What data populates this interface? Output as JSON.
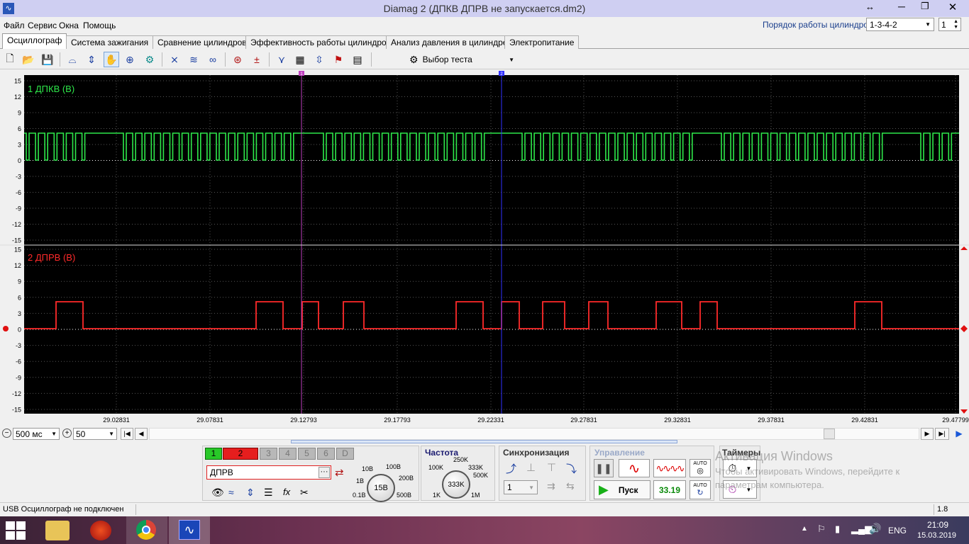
{
  "window": {
    "title": "Diamag 2 (ДПКВ ДПРВ не запускается.dm2)",
    "cylinder_order_label": "Порядок работы цилиндров",
    "cylinder_order_value": "1-3-4-2",
    "cylinder_index": "1"
  },
  "menu": [
    "Файл",
    "Сервис",
    "Окна",
    "Помощь"
  ],
  "tabs": [
    "Осциллограф",
    "Система зажигания",
    "Сравнение цилиндров",
    "Эффективность работы цилиндров",
    "Анализ давления в цилиндре",
    "Электропитание"
  ],
  "toolbar": {
    "test_select": "Выбор теста"
  },
  "scope": {
    "channel1_label": "1 ДПКВ (В)",
    "channel2_label": "2 ДПРВ (В)",
    "y_ticks": [
      "15",
      "12",
      "9",
      "6",
      "3",
      "0",
      "-3",
      "-6",
      "-9",
      "-12",
      "-15"
    ],
    "x_ticks": [
      "29.02831",
      "29.07831",
      "29.12793",
      "29.17793",
      "29.22331",
      "29.27831",
      "29.32831",
      "29.37831",
      "29.42831",
      "29.47799"
    ],
    "cursor1": "1",
    "cursor2": "2",
    "colors": {
      "channel1": "#2ee84a",
      "channel2": "#ff2a2a",
      "cursor1": "#c040c0",
      "cursor2": "#3030ff"
    }
  },
  "timebase": {
    "time_div": "500 мс",
    "zoom": "50"
  },
  "controls": {
    "channels": [
      "1",
      "2",
      "3",
      "4",
      "5",
      "6",
      "D"
    ],
    "channel_name": "ДПРВ",
    "volt_knob": {
      "value": "15В",
      "labels": [
        "10В",
        "100В",
        "1В",
        "200В",
        "0.1В",
        "500В"
      ]
    },
    "freq_title": "Частота",
    "freq_knob": {
      "value": "333K",
      "labels": [
        "250K",
        "100K",
        "333K",
        "500K",
        "1K",
        "1M"
      ]
    },
    "sync_title": "Синхронизация",
    "sync_value": "1",
    "control_title": "Управление",
    "start_label": "Пуск",
    "rate_value": "33.19",
    "auto_label": "AUTO",
    "timers_title": "Таймеры"
  },
  "watermark": {
    "line1": "Активация Windows",
    "line2": "Чтобы активировать Windows, перейдите к",
    "line3": "параметрам компьютера."
  },
  "status": {
    "text": "USB Осциллограф не подключен",
    "version": "1.8"
  },
  "taskbar": {
    "lang": "ENG",
    "time": "21:09",
    "date": "15.03.2019"
  }
}
